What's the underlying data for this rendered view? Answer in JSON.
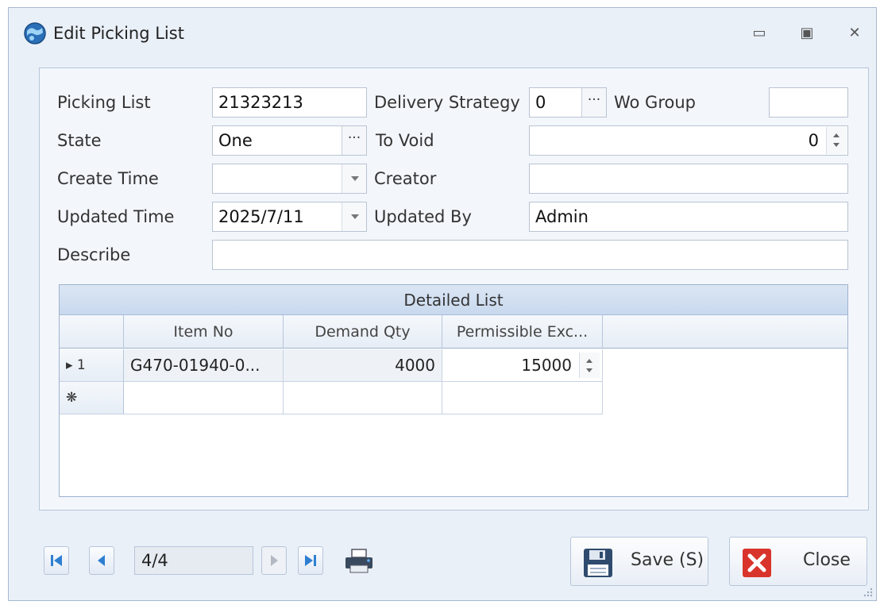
{
  "window": {
    "title": "Edit Picking List",
    "controls": {
      "minimize": "▭",
      "maximize": "▣",
      "close": "✕"
    }
  },
  "form": {
    "picking_list": {
      "label": "Picking List",
      "value": "21323213"
    },
    "delivery_strategy": {
      "label": "Delivery Strategy",
      "value": "0",
      "button": "···"
    },
    "wo_group": {
      "label": "Wo Group",
      "value": ""
    },
    "state": {
      "label": "State",
      "value": "One",
      "button": "···"
    },
    "to_void": {
      "label": "To Void",
      "value": "0"
    },
    "create_time": {
      "label": "Create Time",
      "value": ""
    },
    "creator": {
      "label": "Creator",
      "value": ""
    },
    "updated_time": {
      "label": "Updated Time",
      "value": "2025/7/11"
    },
    "updated_by": {
      "label": "Updated By",
      "value": "Admin"
    },
    "describe": {
      "label": "Describe",
      "value": ""
    }
  },
  "detail_grid": {
    "caption": "Detailed List",
    "columns": [
      "Item No",
      "Demand Qty",
      "Permissible Exc..."
    ],
    "rows": [
      {
        "indicator": "▸ 1",
        "item_no": "G470-01940-0...",
        "demand_qty": "4000",
        "permissible": "15000"
      }
    ],
    "new_row_indicator": "❋"
  },
  "navigator": {
    "position": "4/4"
  },
  "buttons": {
    "save": "Save (S)",
    "close": "Close"
  },
  "colors": {
    "accent": "#2f7fd1",
    "close_red": "#d9342b",
    "window_bg": "#eaf0f8"
  },
  "icons": [
    "app-globe-icon",
    "first-record-icon",
    "prev-record-icon",
    "next-record-icon",
    "last-record-icon",
    "print-icon",
    "save-disk-icon",
    "close-x-icon"
  ]
}
